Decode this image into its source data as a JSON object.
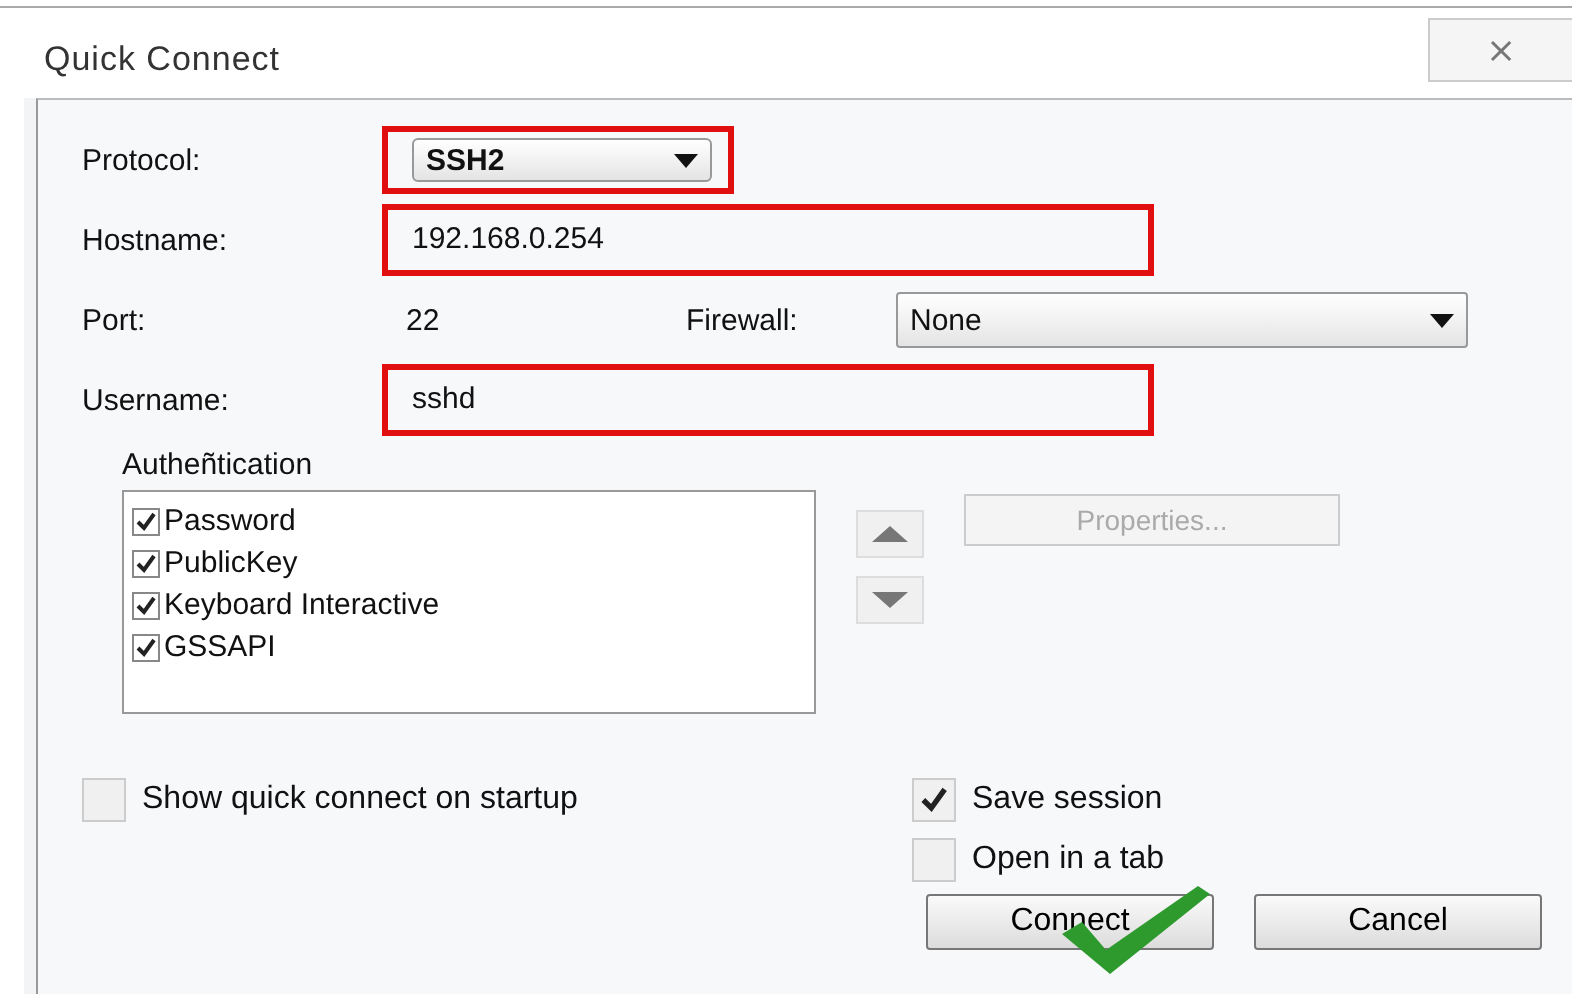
{
  "window": {
    "title": "Quick Connect",
    "close": "⨯"
  },
  "protocol": {
    "label": "Protocol:",
    "value": "SSH2",
    "highlighted": true
  },
  "hostname": {
    "label": "Hostname:",
    "value": "192.168.0.254",
    "highlighted": true
  },
  "port": {
    "label": "Port:",
    "value": "22"
  },
  "firewall": {
    "label": "Firewall:",
    "value": "None",
    "highlighted": false
  },
  "username": {
    "label": "Username:",
    "value": "sshd",
    "highlighted": true
  },
  "authentication": {
    "label": "Autheñtication",
    "items": [
      {
        "label": "Password",
        "checked": true
      },
      {
        "label": "PublicKey",
        "checked": true
      },
      {
        "label": "Keyboard Interactive",
        "checked": true
      },
      {
        "label": "GSSAPI",
        "checked": true
      }
    ],
    "properties": {
      "label": "Properties...",
      "disabled": true
    }
  },
  "options": [
    {
      "label": "Show quick connect on startup",
      "checked": false
    },
    {
      "label": "Save session",
      "checked": true
    },
    {
      "label": "Open in a tab",
      "checked": false
    }
  ],
  "buttons": [
    {
      "label": "Connect",
      "annotated": true
    },
    {
      "label": "Cancel",
      "annotated": false
    }
  ]
}
